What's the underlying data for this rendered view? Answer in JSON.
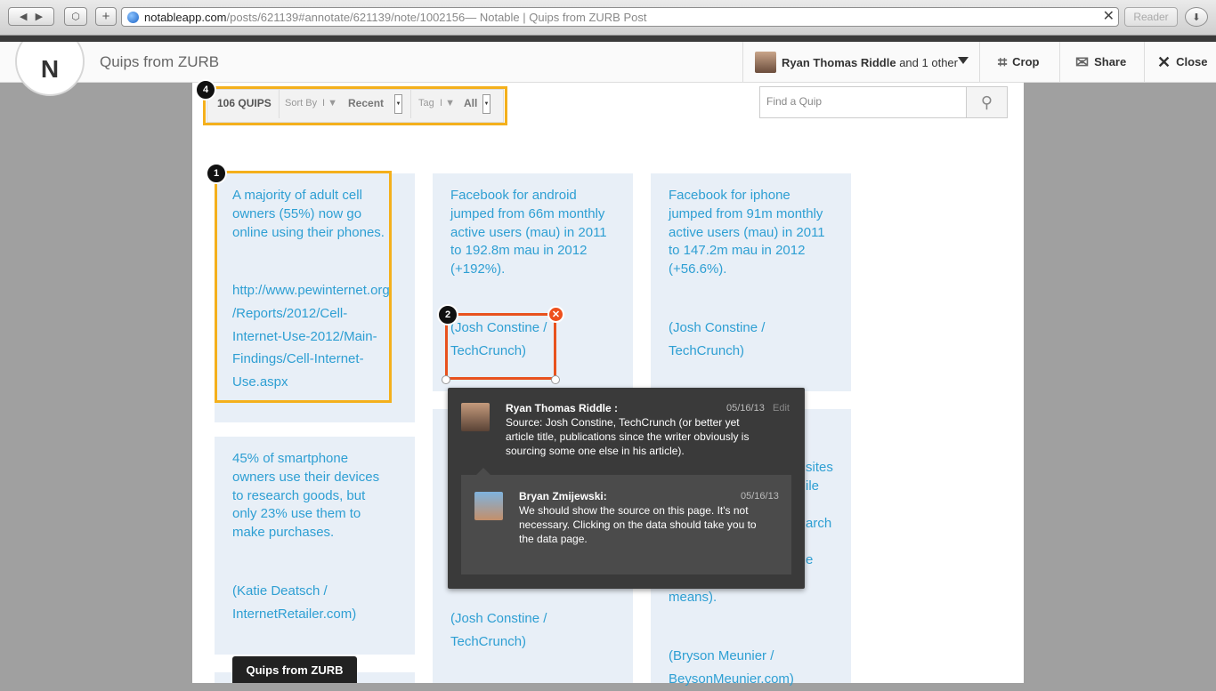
{
  "browser": {
    "url_host": "notableapp.com",
    "url_path": "/posts/621139#annotate/621139/note/1002156",
    "url_title": " — Notable | Quips from ZURB Post",
    "reader": "Reader"
  },
  "header": {
    "logo": "N",
    "title": "Quips from ZURB",
    "collab_name": "Ryan Thomas Riddle",
    "collab_rest": "and 1 other",
    "crop": "Crop",
    "share": "Share",
    "close": "Close"
  },
  "toolbar": {
    "count": "106 QUIPS",
    "sortby_label": "Sort By",
    "sortby_value": "Recent",
    "tag_label": "Tag",
    "tag_value": "All",
    "badge": "4"
  },
  "search": {
    "placeholder": "Find a Quip"
  },
  "cards": {
    "c1": {
      "badge": "1",
      "lines": [
        "A majority of adult cell",
        "owners (55%) now go",
        "online using their phones."
      ],
      "link": [
        "http://www.pewinternet.org",
        "/Reports/2012/Cell-",
        "Internet-Use-2012/Main-",
        "Findings/Cell-Internet-",
        "Use.aspx"
      ]
    },
    "c2": {
      "lines": [
        "Facebook for android",
        "jumped from 66m monthly",
        "active users (mau) in 2011",
        "to 192.8m mau in 2012",
        "(+192%)."
      ],
      "badge": "2",
      "source": [
        "(Josh Constine /",
        "TechCrunch)"
      ]
    },
    "c3": {
      "lines": [
        "Facebook for iphone",
        "jumped from 91m monthly",
        "active users (mau) in 2011",
        "to 147.2m mau in 2012",
        "(+56.6%)."
      ],
      "source": [
        "(Josh Constine /",
        "TechCrunch)"
      ]
    },
    "c4": {
      "lines": [
        "45% of smartphone",
        "owners use their devices",
        "to research goods, but",
        "only 23% use them to",
        "make purchases."
      ],
      "source": [
        "(Katie Deatsch /",
        "InternetRetailer.com)"
      ]
    },
    "c5": {
      "source": [
        "(Josh Constine /",
        "TechCrunch)"
      ]
    },
    "c6": {
      "frag": [
        "sites",
        "ile",
        "arch",
        "e"
      ],
      "lines": [
        "means)."
      ],
      "source": [
        "(Bryson Meunier /",
        "BeysonMeunier.com)"
      ]
    }
  },
  "comments": [
    {
      "name": "Ryan Thomas Riddle :",
      "date": "05/16/13",
      "edit": "Edit",
      "text": [
        "Source: Josh Constine, TechCrunch (or better yet",
        "article title, publications since the writer obviously is",
        "sourcing some one else in his article)."
      ]
    },
    {
      "name": "Bryan Zmijewski:",
      "date": "05/16/13",
      "text": [
        "We should show the source on this page. It's not",
        "necessary. Clicking on the data should take you to",
        "the data page."
      ]
    }
  ],
  "footer_tab": "Quips from ZURB",
  "colors": {
    "accent": "#2e9fd3",
    "highlight": "#f4b01c",
    "selection": "#e8521e",
    "card": "#e8eff7"
  }
}
